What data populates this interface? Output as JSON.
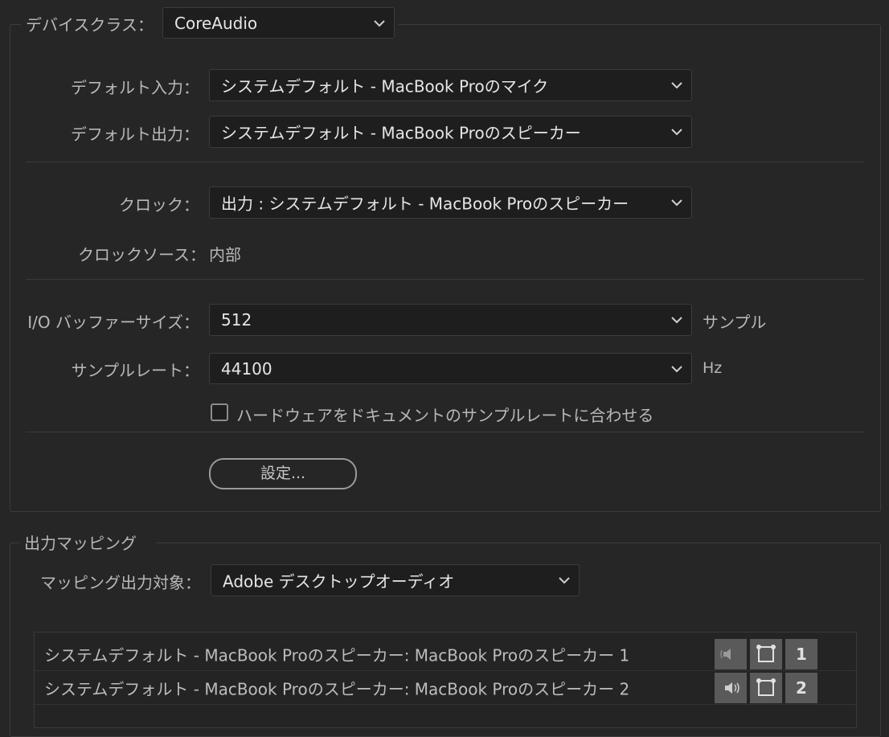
{
  "device": {
    "class_label": "デバイスクラス：",
    "class_value": "CoreAudio",
    "default_input_label": "デフォルト入力：",
    "default_input_value": "システムデフォルト - MacBook Proのマイク",
    "default_output_label": "デフォルト出力：",
    "default_output_value": "システムデフォルト - MacBook Proのスピーカー",
    "clock_label": "クロック：",
    "clock_value": "出力 : システムデフォルト - MacBook Proのスピーカー",
    "clock_source_label": "クロックソース：",
    "clock_source_value": "内部",
    "buffer_label": "I/O バッファーサイズ：",
    "buffer_value": "512",
    "buffer_unit": "サンプル",
    "rate_label": "サンプルレート：",
    "rate_value": "44100",
    "rate_unit": "Hz",
    "match_checkbox_label": "ハードウェアをドキュメントのサンプルレートに合わせる",
    "match_checked": false,
    "settings_button": "設定..."
  },
  "mapping": {
    "section_title": "出力マッピング",
    "target_label": "マッピング出力対象：",
    "target_value": "Adobe デスクトップオーディオ",
    "rows": [
      {
        "name": "システムデフォルト - MacBook Proのスピーカー: MacBook Proのスピーカー 1",
        "channel": "1",
        "icon": "speaker-left-icon"
      },
      {
        "name": "システムデフォルト - MacBook Proのスピーカー: MacBook Proのスピーカー 2",
        "channel": "2",
        "icon": "speaker-right-icon"
      }
    ]
  }
}
